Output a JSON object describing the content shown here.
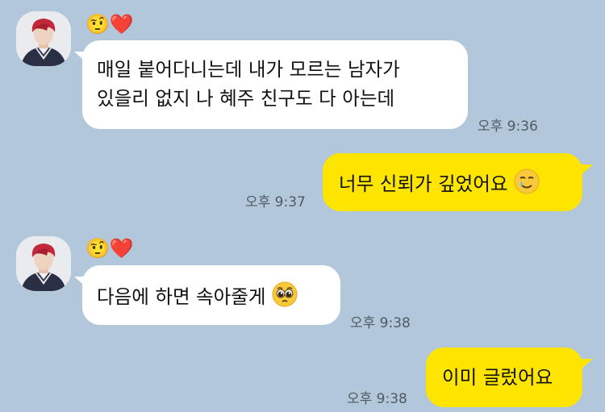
{
  "messages": [
    {
      "direction": "incoming",
      "sender": "🤨❤️",
      "lines": [
        "매일 붙어다니는데 내가 모르는 남자가",
        "있을리 없지 나 혜주 친구도 다 아는데"
      ],
      "time": "오후 9:36"
    },
    {
      "direction": "outgoing",
      "text": "너무 신뢰가 깊었어요",
      "emoji": "🥲",
      "time": "오후 9:37"
    },
    {
      "direction": "incoming",
      "sender": "🤨❤️",
      "text": "다음에 하면 속아줄게",
      "emoji": "🥺",
      "time": "오후 9:38"
    },
    {
      "direction": "outgoing",
      "text": "이미 글렀어요",
      "time": "오후 9:38"
    }
  ],
  "colors": {
    "background": "#b2c7d9",
    "incoming_bubble": "#ffffff",
    "outgoing_bubble": "#fee500",
    "time_text": "#4f5a66"
  },
  "icons": {
    "avatar": "profile-photo",
    "smiling-tear": "smiling-face-with-tear-icon",
    "pleading": "pleading-face-icon"
  }
}
